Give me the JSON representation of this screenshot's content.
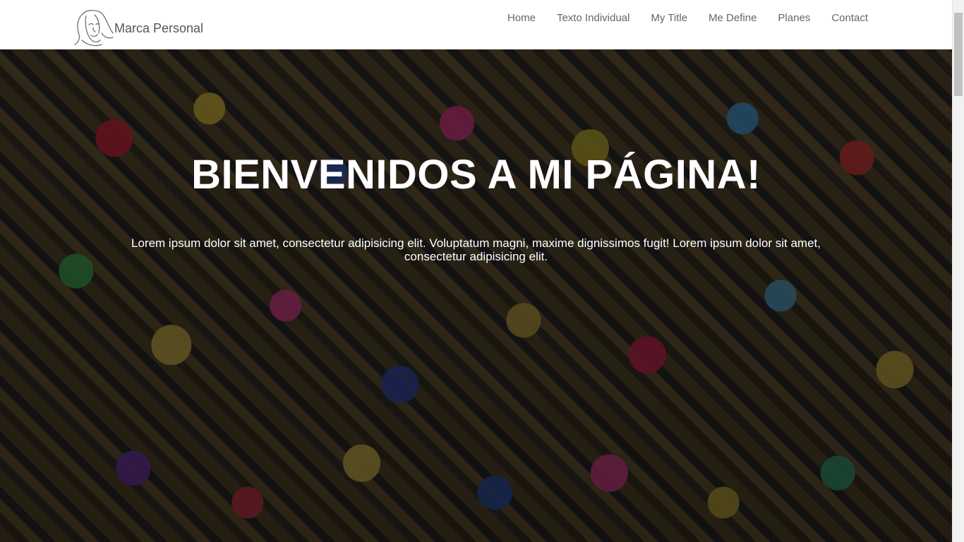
{
  "header": {
    "brand": {
      "name": "Marca Personal",
      "logo_icon": "face-line-art-logo"
    },
    "nav": [
      {
        "label": "Home"
      },
      {
        "label": "Texto Individual"
      },
      {
        "label": "My Title"
      },
      {
        "label": "Me Define"
      },
      {
        "label": "Planes"
      },
      {
        "label": "Contact"
      }
    ]
  },
  "hero": {
    "title": "BIENVENIDOS A MI PÁGINA!",
    "text": "Lorem ipsum dolor sit amet, consectetur adipisicing elit. Voluptatum magni, maxime dignissimos fugit! Lorem ipsum dolor sit amet, consectetur adipisicing elit.",
    "background": "padlocks-photo"
  },
  "colors": {
    "header_bg": "#ffffff",
    "nav_text": "#666666",
    "brand_text": "#555555",
    "hero_text": "#ffffff"
  }
}
